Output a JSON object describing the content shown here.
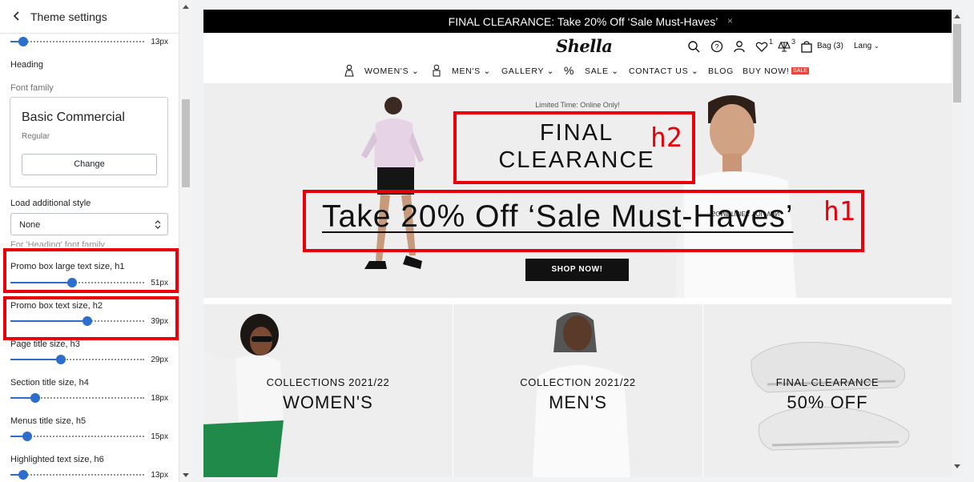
{
  "panel": {
    "title": "Theme settings",
    "top_slider": {
      "value": "13px",
      "level": 0.08
    },
    "heading_section": "Heading",
    "font_family_label": "Font family",
    "font_card": {
      "name": "Basic Commercial",
      "style": "Regular",
      "change_label": "Change"
    },
    "load_style_label": "Load additional style",
    "load_style_value": "None",
    "load_style_note": "For 'Heading' font family",
    "sliders": [
      {
        "label": "Promo box large text size, h1",
        "value": "51px",
        "level": 0.4
      },
      {
        "label": "Promo box text size, h2",
        "value": "39px",
        "level": 0.55
      },
      {
        "label": "Page title size, h3",
        "value": "29px",
        "level": 0.35
      },
      {
        "label": "Section title size, h4",
        "value": "18px",
        "level": 0.18
      },
      {
        "label": "Menus title size, h5",
        "value": "15px",
        "level": 0.12
      },
      {
        "label": "Highlighted text size, h6",
        "value": "13px",
        "level": 0.08
      }
    ]
  },
  "preview": {
    "announcement": "FINAL CLEARANCE: Take 20% Off ‘Sale Must-Haves’",
    "announcement_close": "×",
    "logo": "Shella",
    "wishlist_count": "1",
    "compare_count": "3",
    "bag_label": "Bag (3)",
    "lang_label": "Lang",
    "nav": {
      "womens": "WOMEN'S",
      "mens": "MEN'S",
      "gallery": "GALLERY",
      "sale": "SALE",
      "contact": "CONTACT US",
      "blog": "BLOG",
      "buy_now": "BUY NOW!",
      "sale_badge": "SALE"
    },
    "hero": {
      "kicker": "Limited Time: Online Only!",
      "h2": "FINAL CLEARANCE",
      "h1": "Take 20% Off ‘Sale Must-Haves’",
      "button": "SHOP NOW!",
      "tshirt_text": "SOMETIMES YOU WIN"
    },
    "annotations": {
      "h1": "h1",
      "h2": "h2"
    },
    "collections": [
      {
        "kicker": "COLLECTIONS 2021/22",
        "title": "WOMEN'S"
      },
      {
        "kicker": "COLLECTION 2021/22",
        "title": "MEN'S"
      },
      {
        "kicker": "FINAL CLEARANCE",
        "title": "50% OFF"
      }
    ]
  },
  "colors": {
    "accent": "#2c6ecb",
    "annotation": "#e8000b",
    "sale_badge": "#e8453c"
  }
}
